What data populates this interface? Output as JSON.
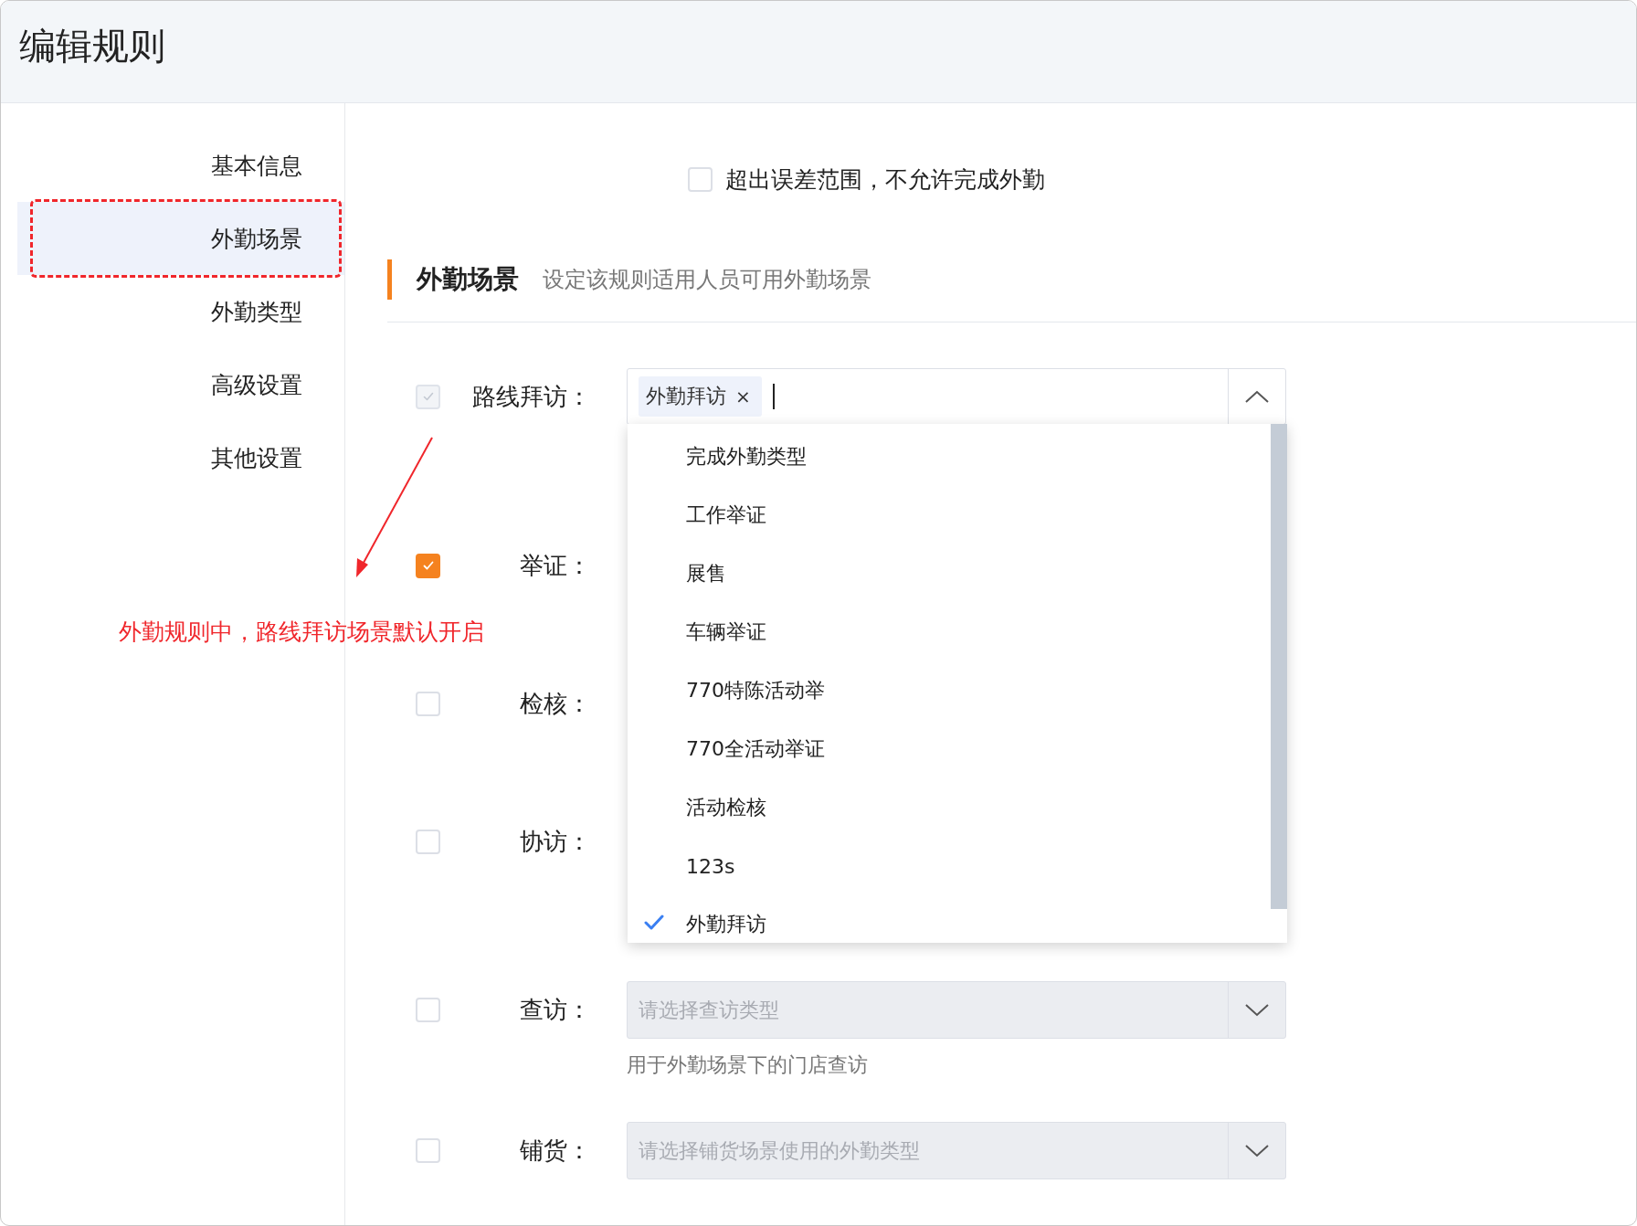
{
  "window": {
    "title": "编辑规则"
  },
  "sidebar": {
    "items": [
      {
        "label": "基本信息",
        "selected": false
      },
      {
        "label": "外勤场景",
        "selected": true
      },
      {
        "label": "外勤类型",
        "selected": false
      },
      {
        "label": "高级设置",
        "selected": false
      },
      {
        "label": "其他设置",
        "selected": false
      }
    ]
  },
  "error_option": {
    "label": "超出误差范围，不允许完成外勤",
    "checked": false
  },
  "section": {
    "title": "外勤场景",
    "description": "设定该规则适用人员可用外勤场景"
  },
  "scenes": [
    {
      "kind": "tags",
      "label": "路线拜访：",
      "checked": true,
      "disabled": true,
      "expanded": true,
      "tags": [
        {
          "text": "外勤拜访",
          "remove": "×"
        }
      ]
    },
    {
      "kind": "plain",
      "label": "举证：",
      "checked": true,
      "disabled": false
    },
    {
      "kind": "plain",
      "label": "检核：",
      "checked": false,
      "disabled": false
    },
    {
      "kind": "plain",
      "label": "协访：",
      "checked": false,
      "disabled": false
    },
    {
      "kind": "select",
      "label": "查访：",
      "checked": false,
      "disabled": false,
      "placeholder": "请选择查访类型",
      "select_disabled": true,
      "hint": "用于外勤场景下的门店查访"
    },
    {
      "kind": "select",
      "label": "铺货：",
      "checked": false,
      "disabled": false,
      "placeholder": "请选择铺货场景使用的外勤类型",
      "select_disabled": true
    }
  ],
  "dropdown": {
    "options": [
      {
        "label": "完成外勤类型",
        "selected": false
      },
      {
        "label": "工作举证",
        "selected": false
      },
      {
        "label": "展售",
        "selected": false
      },
      {
        "label": "车辆举证",
        "selected": false
      },
      {
        "label": "770特陈活动举",
        "selected": false
      },
      {
        "label": "770全活动举证",
        "selected": false
      },
      {
        "label": "活动检核",
        "selected": false
      },
      {
        "label": "123s",
        "selected": false
      },
      {
        "label": "外勤拜访",
        "selected": true
      }
    ]
  },
  "annotation": {
    "text": "外勤规则中，路线拜访场景默认开启",
    "frame_selected": true
  }
}
